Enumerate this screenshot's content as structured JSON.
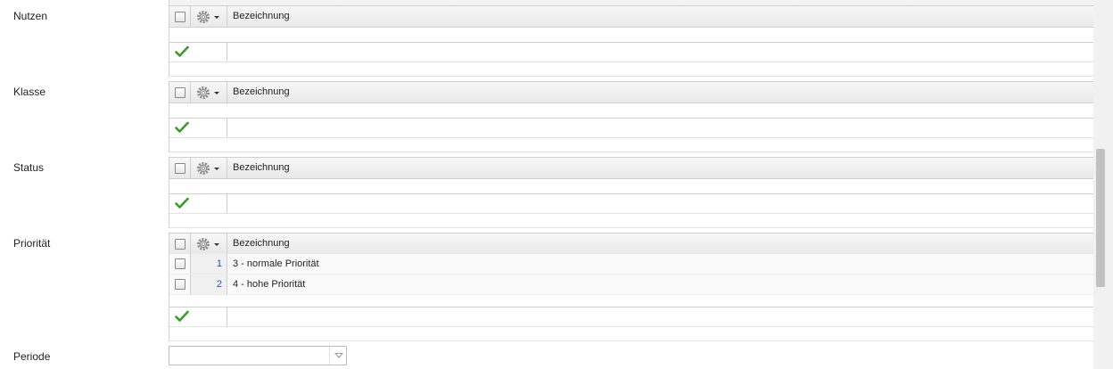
{
  "sections": [
    {
      "label": "Nutzen",
      "header": "Bezeichnung",
      "rows": []
    },
    {
      "label": "Klasse",
      "header": "Bezeichnung",
      "rows": []
    },
    {
      "label": "Status",
      "header": "Bezeichnung",
      "rows": []
    },
    {
      "label": "Priorität",
      "header": "Bezeichnung",
      "rows": [
        {
          "num": "1",
          "text": "3 - normale Priorität"
        },
        {
          "num": "2",
          "text": "4 - hohe Priorität"
        }
      ]
    }
  ],
  "periode": {
    "label": "Periode",
    "value": ""
  },
  "icons": {
    "header_gear": "gear-icon",
    "footer_confirm": "green-checkmark-icon",
    "combo": "dropdown-triangle-icon"
  },
  "colors": {
    "row_number": "#1e4fbf",
    "checkmark": "#3b9a2a"
  }
}
